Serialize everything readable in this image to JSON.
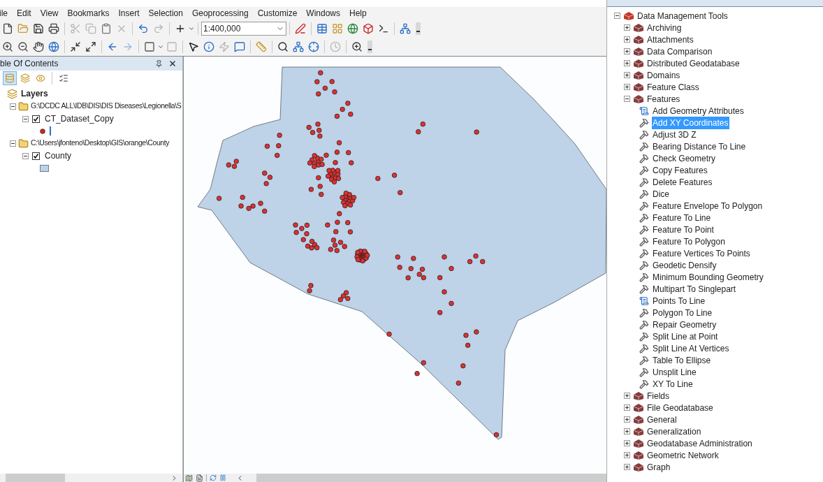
{
  "menu": [
    "ile",
    "Edit",
    "View",
    "Bookmarks",
    "Insert",
    "Selection",
    "Geoprocessing",
    "Customize",
    "Windows",
    "Help"
  ],
  "scale": "1:400,000",
  "toc": {
    "title": "ble Of Contents",
    "view_buttons": [
      {
        "kind": "drawing-order",
        "selected": true
      },
      {
        "kind": "source",
        "selected": false
      },
      {
        "kind": "visibility",
        "selected": false
      },
      {
        "kind": "selection",
        "selected": false
      }
    ],
    "root": "Layers",
    "groups": [
      {
        "path": "G:\\DCDC ALL\\IDB\\DIS\\DIS Diseases\\Legionella\\S",
        "expanded": true,
        "layers": [
          {
            "name": "CT_Dataset_Copy",
            "checked": true,
            "expanded": true,
            "kind": "point"
          }
        ]
      },
      {
        "path": "C:\\Users\\jfonteno\\Desktop\\GIS\\orange\\County",
        "expanded": true,
        "layers": [
          {
            "name": "County",
            "checked": true,
            "expanded": true,
            "kind": "polygon"
          }
        ]
      }
    ]
  },
  "toolbox": {
    "label": "Data Management Tools",
    "expanded": true,
    "children": [
      {
        "label": "Archiving",
        "expanded": false
      },
      {
        "label": "Attachments",
        "expanded": false
      },
      {
        "label": "Data Comparison",
        "expanded": false
      },
      {
        "label": "Distributed Geodatabase",
        "expanded": false
      },
      {
        "label": "Domains",
        "expanded": false
      },
      {
        "label": "Feature Class",
        "expanded": false
      },
      {
        "label": "Features",
        "expanded": true,
        "children": [
          {
            "label": "Add Geometry Attributes",
            "kind": "script",
            "selected": false
          },
          {
            "label": "Add XY Coordinates",
            "kind": "tool",
            "selected": true
          },
          {
            "label": "Adjust 3D Z",
            "kind": "tool",
            "selected": false
          },
          {
            "label": "Bearing Distance To Line",
            "kind": "tool",
            "selected": false
          },
          {
            "label": "Check Geometry",
            "kind": "tool",
            "selected": false
          },
          {
            "label": "Copy Features",
            "kind": "tool",
            "selected": false
          },
          {
            "label": "Delete Features",
            "kind": "tool",
            "selected": false
          },
          {
            "label": "Dice",
            "kind": "tool",
            "selected": false
          },
          {
            "label": "Feature Envelope To Polygon",
            "kind": "tool",
            "selected": false
          },
          {
            "label": "Feature To Line",
            "kind": "tool",
            "selected": false
          },
          {
            "label": "Feature To Point",
            "kind": "tool",
            "selected": false
          },
          {
            "label": "Feature To Polygon",
            "kind": "tool",
            "selected": false
          },
          {
            "label": "Feature Vertices To Points",
            "kind": "tool",
            "selected": false
          },
          {
            "label": "Geodetic Densify",
            "kind": "tool",
            "selected": false
          },
          {
            "label": "Minimum Bounding Geometry",
            "kind": "tool",
            "selected": false
          },
          {
            "label": "Multipart To Singlepart",
            "kind": "tool",
            "selected": false
          },
          {
            "label": "Points To Line",
            "kind": "script",
            "selected": false
          },
          {
            "label": "Polygon To Line",
            "kind": "tool",
            "selected": false
          },
          {
            "label": "Repair Geometry",
            "kind": "tool",
            "selected": false
          },
          {
            "label": "Split Line at Point",
            "kind": "tool",
            "selected": false
          },
          {
            "label": "Split Line At Vertices",
            "kind": "tool",
            "selected": false
          },
          {
            "label": "Table To Ellipse",
            "kind": "tool",
            "selected": false
          },
          {
            "label": "Unsplit Line",
            "kind": "tool",
            "selected": false
          },
          {
            "label": "XY To Line",
            "kind": "tool",
            "selected": false
          }
        ]
      },
      {
        "label": "Fields",
        "expanded": false
      },
      {
        "label": "File Geodatabase",
        "expanded": false
      },
      {
        "label": "General",
        "expanded": false
      },
      {
        "label": "Generalization",
        "expanded": false
      },
      {
        "label": "Geodatabase Administration",
        "expanded": false
      },
      {
        "label": "Geometric Network",
        "expanded": false
      },
      {
        "label": "Graph",
        "expanded": false
      }
    ]
  }
}
